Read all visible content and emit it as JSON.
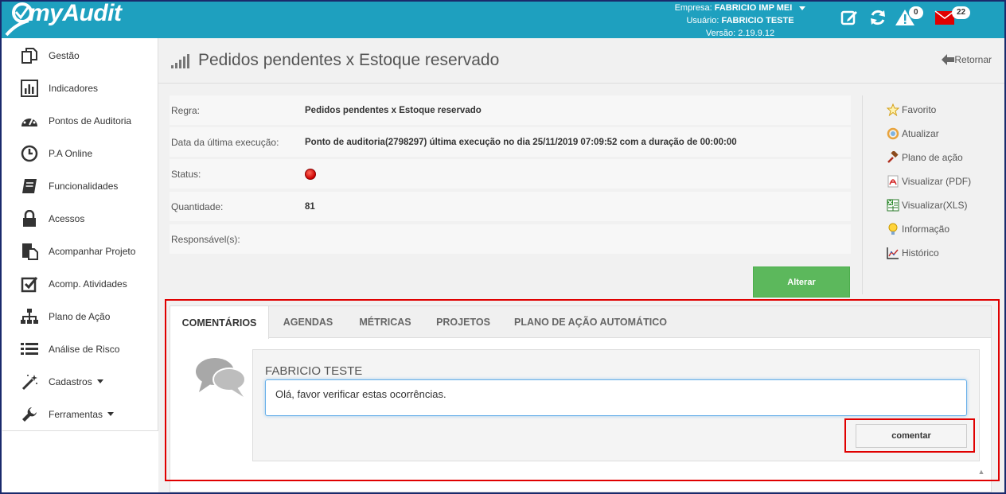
{
  "header": {
    "logo_text": "myAudit",
    "empresa_label": "Empresa:",
    "empresa_value": "FABRICIO IMP MEI",
    "usuario_label": "Usuário:",
    "usuario_value": "FABRICIO TESTE",
    "versao_label": "Versão:",
    "versao_value": "2.19.9.12",
    "alerts_count": "0",
    "messages_count": "22"
  },
  "sidebar": {
    "items": [
      {
        "label": "Gestão",
        "icon": "copy-icon"
      },
      {
        "label": "Indicadores",
        "icon": "bar-chart-icon"
      },
      {
        "label": "Pontos de Auditoria",
        "icon": "dashboard-icon"
      },
      {
        "label": "P.A Online",
        "icon": "clock-icon"
      },
      {
        "label": "Funcionalidades",
        "icon": "book-icon"
      },
      {
        "label": "Acessos",
        "icon": "lock-icon"
      },
      {
        "label": "Acompanhar Projeto",
        "icon": "project-icon"
      },
      {
        "label": "Acomp. Atividades",
        "icon": "checkbox-icon"
      },
      {
        "label": "Plano de Ação",
        "icon": "sitemap-icon"
      },
      {
        "label": "Análise de Risco",
        "icon": "list-icon"
      },
      {
        "label": "Cadastros",
        "icon": "magic-wand-icon"
      },
      {
        "label": "Ferramentas",
        "icon": "wrench-icon"
      }
    ]
  },
  "page": {
    "title": "Pedidos pendentes x Estoque reservado",
    "back_label": "Retornar"
  },
  "info": {
    "regra_label": "Regra:",
    "regra_value": "Pedidos pendentes x Estoque reservado",
    "execucao_label": "Data da última execução:",
    "execucao_value": "Ponto de auditoria(2798297) última execução no dia 25/11/2019 07:09:52 com a duração de 00:00:00",
    "status_label": "Status:",
    "status_color": "#cc0000",
    "quantidade_label": "Quantidade:",
    "quantidade_value": "81",
    "responsavel_label": "Responsável(s):",
    "responsavel_value": ""
  },
  "alterar_label": "Alterar",
  "actions": [
    {
      "label": "Favorito",
      "icon": "star-icon"
    },
    {
      "label": "Atualizar",
      "icon": "refresh-icon"
    },
    {
      "label": "Plano de ação",
      "icon": "gavel-icon"
    },
    {
      "label": "Visualizar (PDF)",
      "icon": "pdf-icon"
    },
    {
      "label": "Visualizar(XLS)",
      "icon": "excel-icon"
    },
    {
      "label": "Informação",
      "icon": "lightbulb-icon"
    },
    {
      "label": "Histórico",
      "icon": "history-chart-icon"
    }
  ],
  "tabs": [
    {
      "label": "COMENTÁRIOS",
      "active": true
    },
    {
      "label": "AGENDAS"
    },
    {
      "label": "MÉTRICAS"
    },
    {
      "label": "PROJETOS"
    },
    {
      "label": "PLANO DE AÇÃO AUTOMÁTICO"
    }
  ],
  "comment": {
    "user": "FABRICIO TESTE",
    "text": "Olá, favor verificar estas ocorrências.",
    "submit_label": "comentar"
  }
}
